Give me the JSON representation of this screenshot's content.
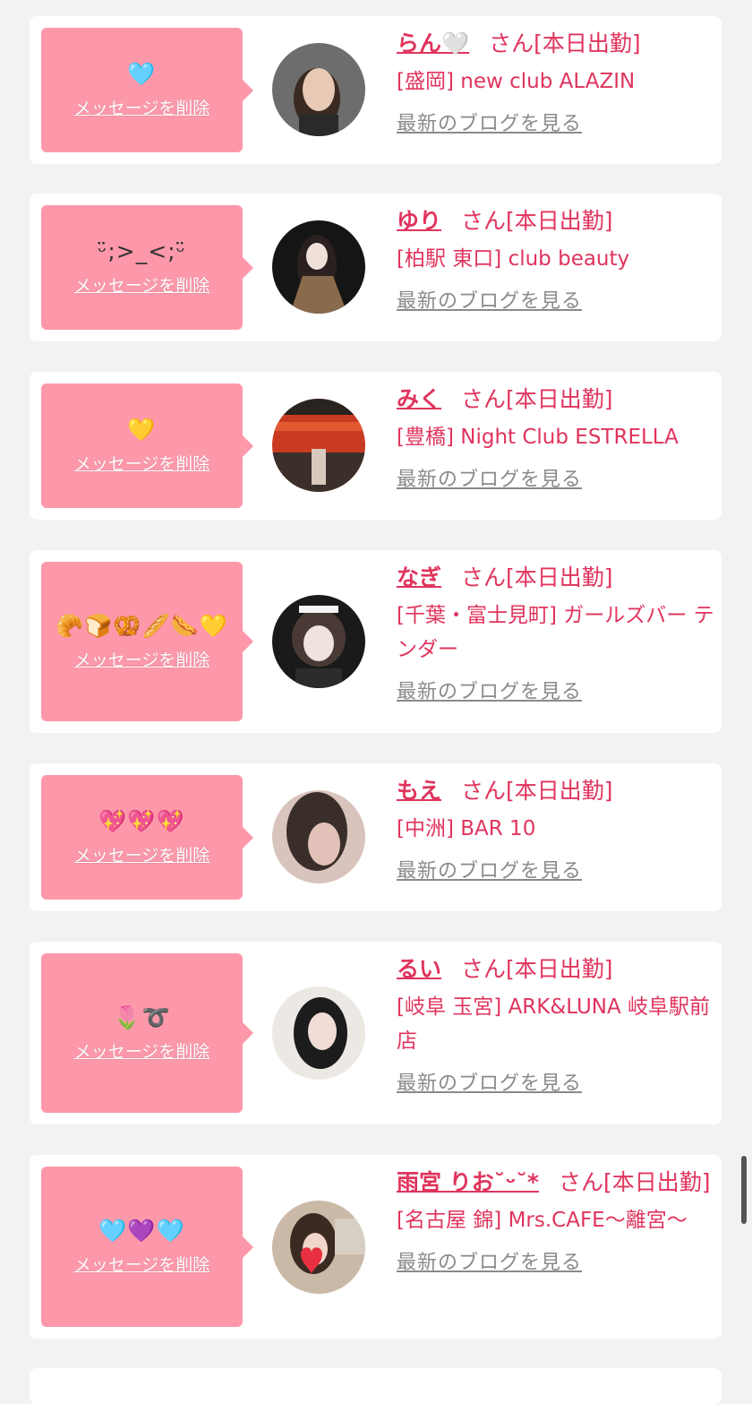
{
  "common": {
    "delete_label": "メッセージを削除",
    "blog_label": "最新のブログを見る"
  },
  "cards": [
    {
      "message": "🩵",
      "name": "らん🤍",
      "suffix": "さん[本日出勤]",
      "shop": "[盛岡] new club ALAZIN",
      "avatar_colors": [
        "#6d6d6d",
        "#e8c9b5"
      ]
    },
    {
      "message": "ᵕ̈;>_<;ᵕ̈",
      "name": "ゆり",
      "suffix": "さん[本日出勤]",
      "shop": "[柏駅 東口] club beauty",
      "avatar_colors": [
        "#151515",
        "#8a6a4c"
      ]
    },
    {
      "message": "💛",
      "name": "みく",
      "suffix": "さん[本日出勤]",
      "shop": "[豊橋] Night Club ESTRELLA",
      "avatar_colors": [
        "#c83a22",
        "#3a2f2a"
      ]
    },
    {
      "message": "🥐🍞🥨🥖🌭💛",
      "name": "なぎ",
      "suffix": "さん[本日出勤]",
      "shop": "[千葉・富士見町] ガールズバー テンダー",
      "avatar_colors": [
        "#1a1a1a",
        "#f0e2dc"
      ]
    },
    {
      "message": "💖💖💖",
      "name": "もえ",
      "suffix": "さん[本日出勤]",
      "shop": "[中洲] BAR 10",
      "avatar_colors": [
        "#3a2e2a",
        "#e2c2b8"
      ]
    },
    {
      "message": "🌷➰",
      "name": "るい",
      "suffix": "さん[本日出勤]",
      "shop": "[岐阜 玉宮] ARK&LUNA 岐阜駅前店",
      "avatar_colors": [
        "#ece8e4",
        "#1c1c1c"
      ]
    },
    {
      "message": "🩵💜🩵",
      "name": "雨宮 りお˘ᵕ˘*",
      "suffix": "さん[本日出勤]",
      "shop": "[名古屋 錦] Mrs.CAFE〜離宮〜",
      "avatar_colors": [
        "#c9b9a6",
        "#e83040"
      ]
    }
  ]
}
